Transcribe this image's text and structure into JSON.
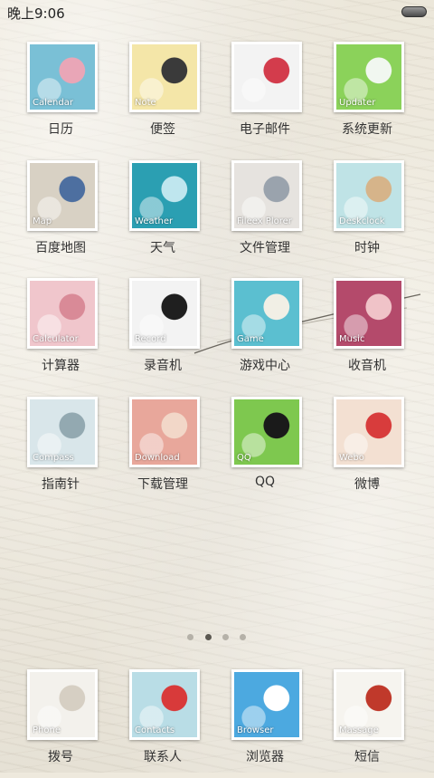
{
  "status": {
    "time": "晚上9:06"
  },
  "apps": [
    {
      "label": "日历",
      "en": "Calendar",
      "icon": "perfume-bottle-icon",
      "colors": [
        "#7ac0d6",
        "#e9a6b7"
      ]
    },
    {
      "label": "便签",
      "en": "Note",
      "icon": "smile-note-icon",
      "colors": [
        "#f4e6a8",
        "#3a3a3a"
      ]
    },
    {
      "label": "电子邮件",
      "en": "",
      "icon": "heart-letter-icon",
      "colors": [
        "#f3f3f3",
        "#d33c4c"
      ]
    },
    {
      "label": "系统更新",
      "en": "Updater",
      "icon": "glass-jar-icon",
      "colors": [
        "#8bd25a",
        "#f1f7f0"
      ]
    },
    {
      "label": "百度地图",
      "en": "Map",
      "icon": "sneakers-icon",
      "colors": [
        "#d8d1c4",
        "#4d6fa0"
      ]
    },
    {
      "label": "天气",
      "en": "Weather",
      "icon": "ocean-icon",
      "colors": [
        "#2b9fb2",
        "#bfe6ee"
      ]
    },
    {
      "label": "文件管理",
      "en": "Fileex Plorer",
      "icon": "files-icon",
      "colors": [
        "#e6e3df",
        "#9aa3ad"
      ]
    },
    {
      "label": "时钟",
      "en": "Deskclock",
      "icon": "wind-chime-icon",
      "colors": [
        "#bfe3e6",
        "#d6b48a"
      ]
    },
    {
      "label": "计算器",
      "en": "Calculator",
      "icon": "calculator-icon",
      "colors": [
        "#f0c6cc",
        "#d98a97"
      ]
    },
    {
      "label": "录音机",
      "en": "Record",
      "icon": "cassette-icon",
      "colors": [
        "#f3f3f3",
        "#1f1f1f"
      ]
    },
    {
      "label": "游戏中心",
      "en": "Game",
      "icon": "scrabble-tiles-icon",
      "colors": [
        "#5bbfd0",
        "#f1efe5"
      ]
    },
    {
      "label": "收音机",
      "en": "Music",
      "icon": "guitar-hand-icon",
      "colors": [
        "#b44a6b",
        "#f0c3c8"
      ]
    },
    {
      "label": "指南针",
      "en": "Compass",
      "icon": "window-icon",
      "colors": [
        "#d9e6ea",
        "#93a9b1"
      ]
    },
    {
      "label": "下载管理",
      "en": "Download",
      "icon": "heart-hands-icon",
      "colors": [
        "#e8a79b",
        "#f2d7c8"
      ]
    },
    {
      "label": "QQ",
      "en": "QQ",
      "icon": "penguin-icon",
      "colors": [
        "#7ec84f",
        "#1a1a1a"
      ]
    },
    {
      "label": "微博",
      "en": "Webo",
      "icon": "cartoon-birds-icon",
      "colors": [
        "#f3e0d2",
        "#d83c3c"
      ]
    }
  ],
  "pager": {
    "count": 4,
    "active": 1
  },
  "dock": [
    {
      "label": "拨号",
      "en": "Phone",
      "icon": "telephone-icon",
      "colors": [
        "#f3f1ec",
        "#d6cfc3"
      ]
    },
    {
      "label": "联系人",
      "en": "Contacts",
      "icon": "cherries-icon",
      "colors": [
        "#b9dde6",
        "#d83a3a"
      ]
    },
    {
      "label": "浏览器",
      "en": "Browser",
      "icon": "heart-cloud-icon",
      "colors": [
        "#4ca9e0",
        "#ffffff"
      ]
    },
    {
      "label": "短信",
      "en": "Massage",
      "icon": "miss-you-note-icon",
      "colors": [
        "#f6f4ef",
        "#c0392b"
      ]
    }
  ]
}
